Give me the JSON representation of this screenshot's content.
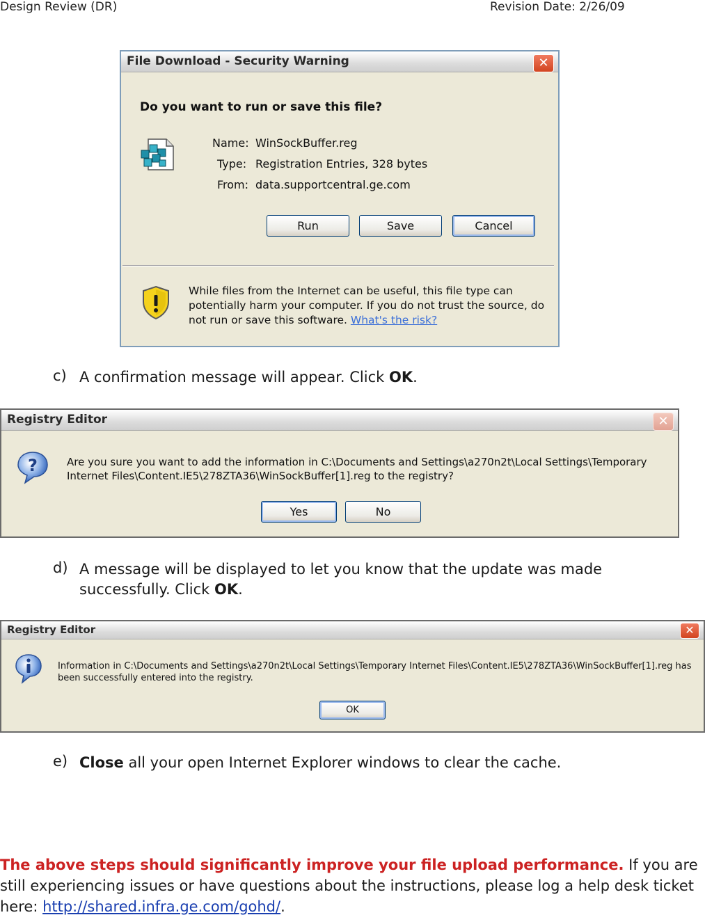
{
  "header": {
    "left": "Design Review (DR)",
    "right": "Revision Date: 2/26/09"
  },
  "download_dialog": {
    "title": "File Download - Security Warning",
    "question": "Do you want to run or save this file?",
    "name_label": "Name:",
    "name_value": "WinSockBuffer.reg",
    "type_label": "Type:",
    "type_value": "Registration Entries, 328 bytes",
    "from_label": "From:",
    "from_value": "data.supportcentral.ge.com",
    "run_label": "Run",
    "save_label": "Save",
    "cancel_label": "Cancel",
    "warning_text": "While files from the Internet can be useful, this file type can potentially harm your computer. If you do not trust the source, do not run or save this software.",
    "risk_link": "What's the risk?"
  },
  "step_c": {
    "marker": "c)",
    "text": "A confirmation message will appear. Click ",
    "bold": "OK",
    "tail": "."
  },
  "confirm_dialog": {
    "title": "Registry Editor",
    "message": "Are you sure you want to add the information in C:\\Documents and Settings\\a270n2t\\Local Settings\\Temporary Internet Files\\Content.IE5\\278ZTA36\\WinSockBuffer[1].reg to the registry?",
    "yes_label": "Yes",
    "no_label": "No"
  },
  "step_d": {
    "marker": "d)",
    "text": "A message will be displayed to let you know that the update was made successfully. Click ",
    "bold": "OK",
    "tail": "."
  },
  "info_dialog": {
    "title": "Registry Editor",
    "message": "Information in C:\\Documents and Settings\\a270n2t\\Local Settings\\Temporary Internet Files\\Content.IE5\\278ZTA36\\WinSockBuffer[1].reg has been successfully entered into the registry.",
    "ok_label": "OK"
  },
  "step_e": {
    "marker": "e)",
    "bold": "Close",
    "text": " all your open Internet Explorer windows to clear the cache."
  },
  "footer": {
    "highlight": "The above steps should significantly improve your file upload performance.",
    "text": " If you are still experiencing issues or have questions about the instructions, please log a help desk ticket here: ",
    "link": "http://shared.infra.ge.com/gohd/",
    "tail": "."
  }
}
